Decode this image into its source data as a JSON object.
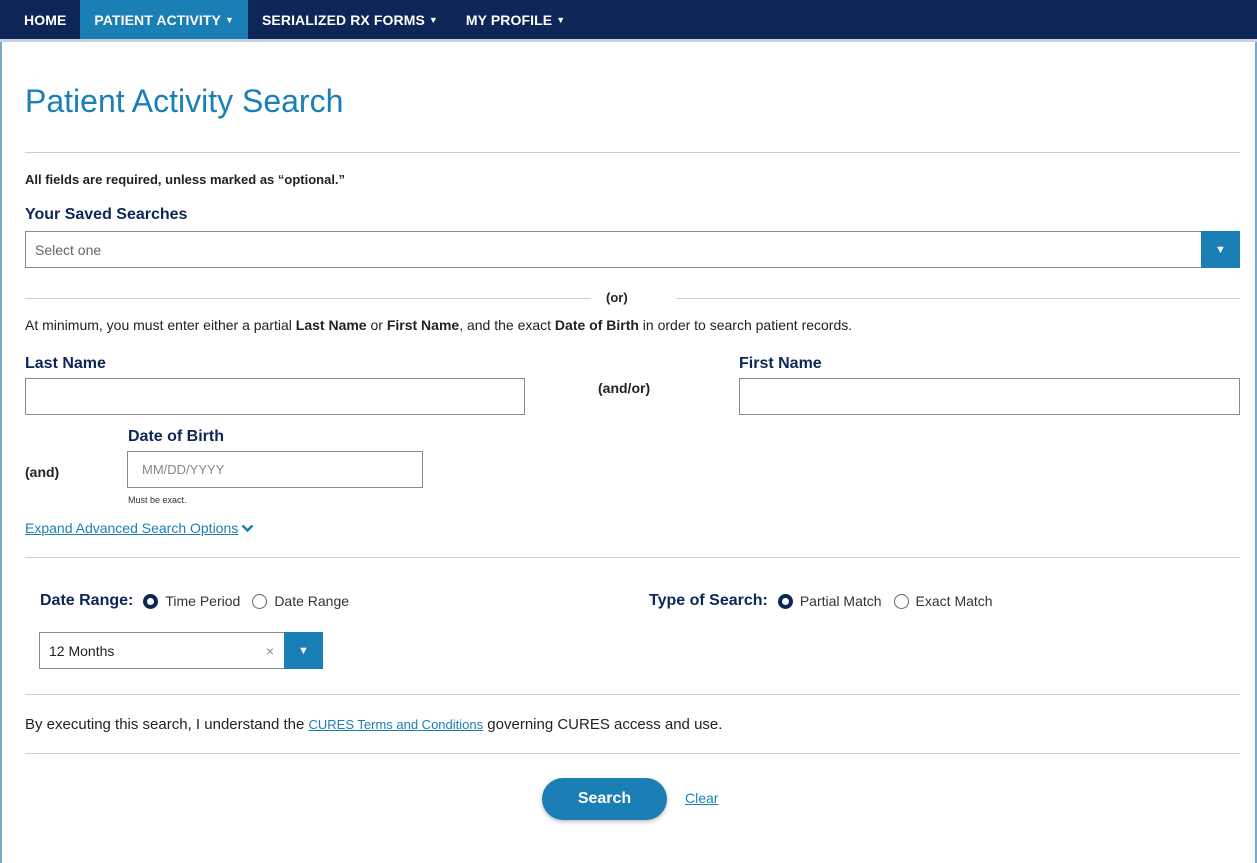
{
  "nav": {
    "items": [
      {
        "label": "HOME"
      },
      {
        "label": "PATIENT ACTIVITY",
        "active": true
      },
      {
        "label": "SERIALIZED RX FORMS"
      },
      {
        "label": "MY PROFILE"
      }
    ]
  },
  "page": {
    "title": "Patient Activity Search",
    "required_note": "All fields are required, unless marked as “optional.”"
  },
  "saved_searches": {
    "label": "Your Saved Searches",
    "placeholder": "Select one"
  },
  "or_text": "(or)",
  "instructions": {
    "part1": "At minimum, you must enter either a partial ",
    "last_name": "Last Name",
    "part2": " or ",
    "first_name": "First Name",
    "part3": ", and the exact ",
    "dob": "Date of Birth",
    "part4": " in order to search patient records."
  },
  "fields": {
    "last_name_label": "Last Name",
    "last_name_value": "",
    "andor": "(and/or)",
    "first_name_label": "First Name",
    "first_name_value": "",
    "and": "(and)",
    "dob_label": "Date of Birth",
    "dob_placeholder": "MM/DD/YYYY",
    "dob_hint": "Must be exact."
  },
  "advanced": {
    "label": "Expand Advanced Search Options"
  },
  "date_range": {
    "label": "Date Range:",
    "options": [
      "Time Period",
      "Date Range"
    ],
    "selected": "Time Period",
    "period_value": "12 Months",
    "clear_symbol": "×"
  },
  "search_type": {
    "label": "Type of Search:",
    "options": [
      "Partial Match",
      "Exact Match"
    ],
    "selected": "Partial Match"
  },
  "terms": {
    "before": "By executing this search, I understand the ",
    "link": "CURES Terms and Conditions",
    "after": " governing CURES access and use."
  },
  "actions": {
    "search": "Search",
    "clear": "Clear"
  },
  "colors": {
    "nav_bg": "#0d2657",
    "accent": "#1a7fb5"
  },
  "icons": {
    "dropdown": "caret-down-icon",
    "expand": "chevron-down-icon"
  }
}
